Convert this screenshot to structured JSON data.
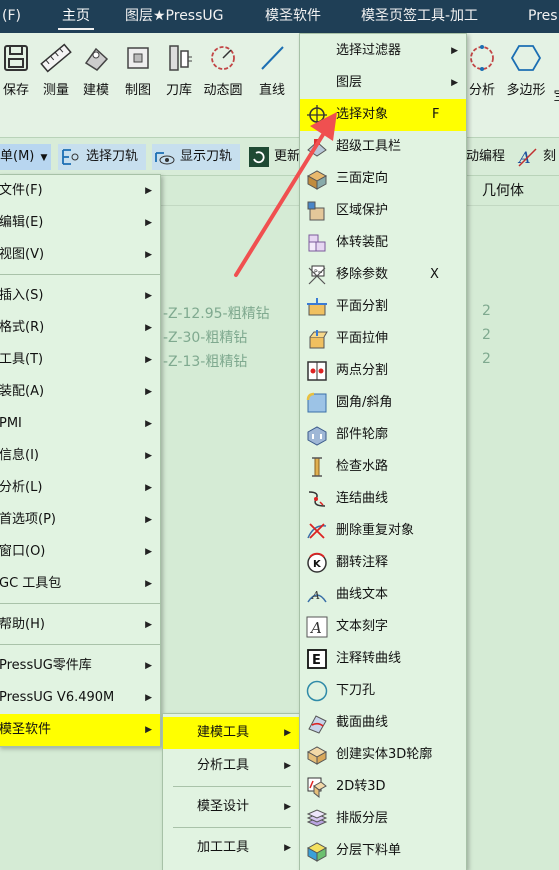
{
  "titlebar": {
    "tabs": [
      {
        "label": "(F)"
      },
      {
        "label": "主页"
      },
      {
        "label": "图层★PressUG"
      },
      {
        "label": "模圣软件"
      },
      {
        "label": "模圣页签工具-加工"
      },
      {
        "label": "Pres"
      }
    ]
  },
  "ribbon": {
    "buttons": [
      {
        "label": "保存",
        "icon": "save-icon"
      },
      {
        "label": "测量",
        "icon": "ruler-icon"
      },
      {
        "label": "建模",
        "icon": "model-icon"
      },
      {
        "label": "制图",
        "icon": "drawing-icon"
      },
      {
        "label": "刀库",
        "icon": "tool-library-icon"
      },
      {
        "label": "动态圆",
        "icon": "dynamic-circle-icon"
      },
      {
        "label": "直线",
        "icon": "line-icon"
      },
      {
        "label": "分析",
        "icon": "analysis-icon"
      },
      {
        "label": "多边形",
        "icon": "polygon-icon"
      },
      {
        "label": "宝",
        "icon": "cut-off-icon"
      }
    ]
  },
  "toolbar2": {
    "menu_label": "菜单(M)",
    "menu_short": "单(M)",
    "select_toolpath": "选择刀轨",
    "show_toolpath": "显示刀轨",
    "update": "更新",
    "auto_programming": "动编程",
    "engrave": "刻"
  },
  "content": {
    "column_header": "几何体",
    "rows": [
      {
        "name": "-Z-12.95-粗精钻",
        "value": "2"
      },
      {
        "name": "-Z-30-粗精钻",
        "value": "2"
      },
      {
        "name": "-Z-13-粗精钻",
        "value": "2"
      }
    ]
  },
  "main_menu": {
    "items": [
      {
        "label": "文件(F)"
      },
      {
        "label": "编辑(E)"
      },
      {
        "label": "视图(V)"
      },
      {
        "label": "插入(S)"
      },
      {
        "label": "格式(R)"
      },
      {
        "label": "工具(T)"
      },
      {
        "label": "装配(A)"
      },
      {
        "label": "PMI"
      },
      {
        "label": "信息(I)"
      },
      {
        "label": "分析(L)"
      },
      {
        "label": "首选项(P)"
      },
      {
        "label": "窗口(O)"
      },
      {
        "label": "GC 工具包"
      },
      {
        "label": "帮助(H)"
      },
      {
        "label": "PressUG零件库"
      },
      {
        "label": "PressUG V6.490M"
      },
      {
        "label": "模圣软件"
      }
    ]
  },
  "mosheng_submenu": {
    "items": [
      {
        "label": "建模工具"
      },
      {
        "label": "分析工具"
      },
      {
        "label": "模圣设计"
      },
      {
        "label": "加工工具"
      }
    ]
  },
  "tools_submenu": {
    "items": [
      {
        "label": "选择过滤器",
        "icon": "",
        "shortcut": ""
      },
      {
        "label": "图层",
        "icon": "",
        "shortcut": ""
      },
      {
        "label": "选择对象",
        "icon": "crosshair-icon",
        "shortcut": "F"
      },
      {
        "label": "超级工具栏",
        "icon": "super-toolbar-icon",
        "shortcut": ""
      },
      {
        "label": "三面定向",
        "icon": "three-face-orient-icon",
        "shortcut": ""
      },
      {
        "label": "区域保护",
        "icon": "region-protect-icon",
        "shortcut": ""
      },
      {
        "label": "体转装配",
        "icon": "body-to-assembly-icon",
        "shortcut": ""
      },
      {
        "label": "移除参数",
        "icon": "remove-params-icon",
        "shortcut": "X"
      },
      {
        "label": "平面分割",
        "icon": "plane-split-icon",
        "shortcut": ""
      },
      {
        "label": "平面拉伸",
        "icon": "plane-extrude-icon",
        "shortcut": ""
      },
      {
        "label": "两点分割",
        "icon": "two-point-split-icon",
        "shortcut": ""
      },
      {
        "label": "圆角/斜角",
        "icon": "fillet-chamfer-icon",
        "shortcut": ""
      },
      {
        "label": "部件轮廓",
        "icon": "part-outline-icon",
        "shortcut": ""
      },
      {
        "label": "检查水路",
        "icon": "check-waterway-icon",
        "shortcut": ""
      },
      {
        "label": "连结曲线",
        "icon": "join-curve-icon",
        "shortcut": ""
      },
      {
        "label": "删除重复对象",
        "icon": "delete-duplicates-icon",
        "shortcut": ""
      },
      {
        "label": "翻转注释",
        "icon": "flip-annotation-icon",
        "shortcut": ""
      },
      {
        "label": "曲线文本",
        "icon": "curve-text-icon",
        "shortcut": ""
      },
      {
        "label": "文本刻字",
        "icon": "text-engrave-icon",
        "shortcut": ""
      },
      {
        "label": "注释转曲线",
        "icon": "annotation-to-curve-icon",
        "shortcut": ""
      },
      {
        "label": "下刀孔",
        "icon": "plunge-hole-icon",
        "shortcut": ""
      },
      {
        "label": "截面曲线",
        "icon": "section-curve-icon",
        "shortcut": ""
      },
      {
        "label": "创建实体3D轮廓",
        "icon": "solid-3d-outline-icon",
        "shortcut": ""
      },
      {
        "label": "2D转3D",
        "icon": "2d-to-3d-icon",
        "shortcut": ""
      },
      {
        "label": "排版分层",
        "icon": "layout-layer-icon",
        "shortcut": ""
      },
      {
        "label": "分层下料单",
        "icon": "layer-cut-list-icon",
        "shortcut": ""
      }
    ]
  },
  "colors": {
    "titlebar": "#1f3f56",
    "highlight": "#ffff00",
    "menu_bg": "#e1f3e1",
    "annotation_arrow": "#f05050"
  }
}
